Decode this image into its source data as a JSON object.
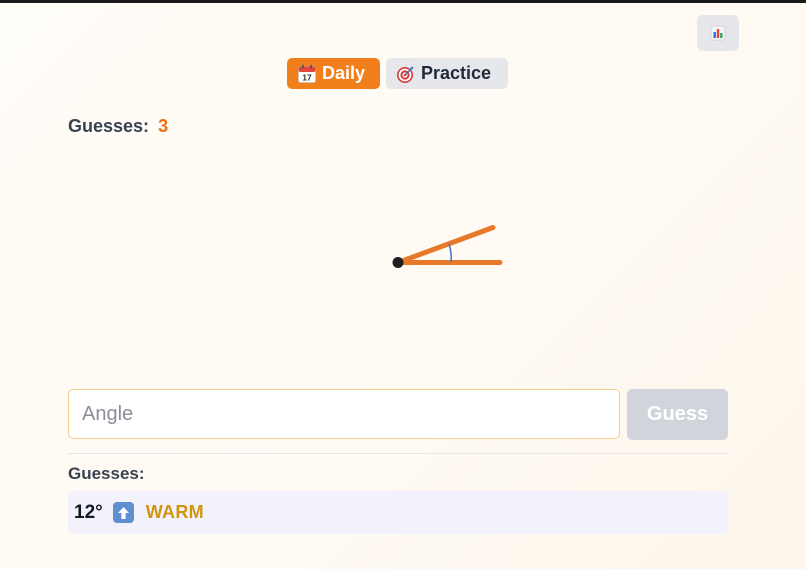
{
  "modes": {
    "daily": {
      "label": "Daily",
      "icon": "calendar-icon",
      "active": true
    },
    "practice": {
      "label": "Practice",
      "icon": "target-icon",
      "active": false
    }
  },
  "stats": {
    "icon": "bar-chart-icon"
  },
  "guess_counter": {
    "label": "Guesses:",
    "value": "3"
  },
  "angle_display": {
    "icon": "angle-figure",
    "accent_color": "#e8782a"
  },
  "input": {
    "placeholder": "Angle",
    "value": ""
  },
  "guess_button": {
    "label": "Guess"
  },
  "history": {
    "label": "Guesses:",
    "items": [
      {
        "degrees": "12°",
        "direction": "up-arrow-icon",
        "hint": "WARM",
        "hint_color": "#d19410"
      }
    ]
  },
  "colors": {
    "accent": "#f07f1c",
    "warm": "#d19410",
    "disabled": "#d1d5db"
  }
}
